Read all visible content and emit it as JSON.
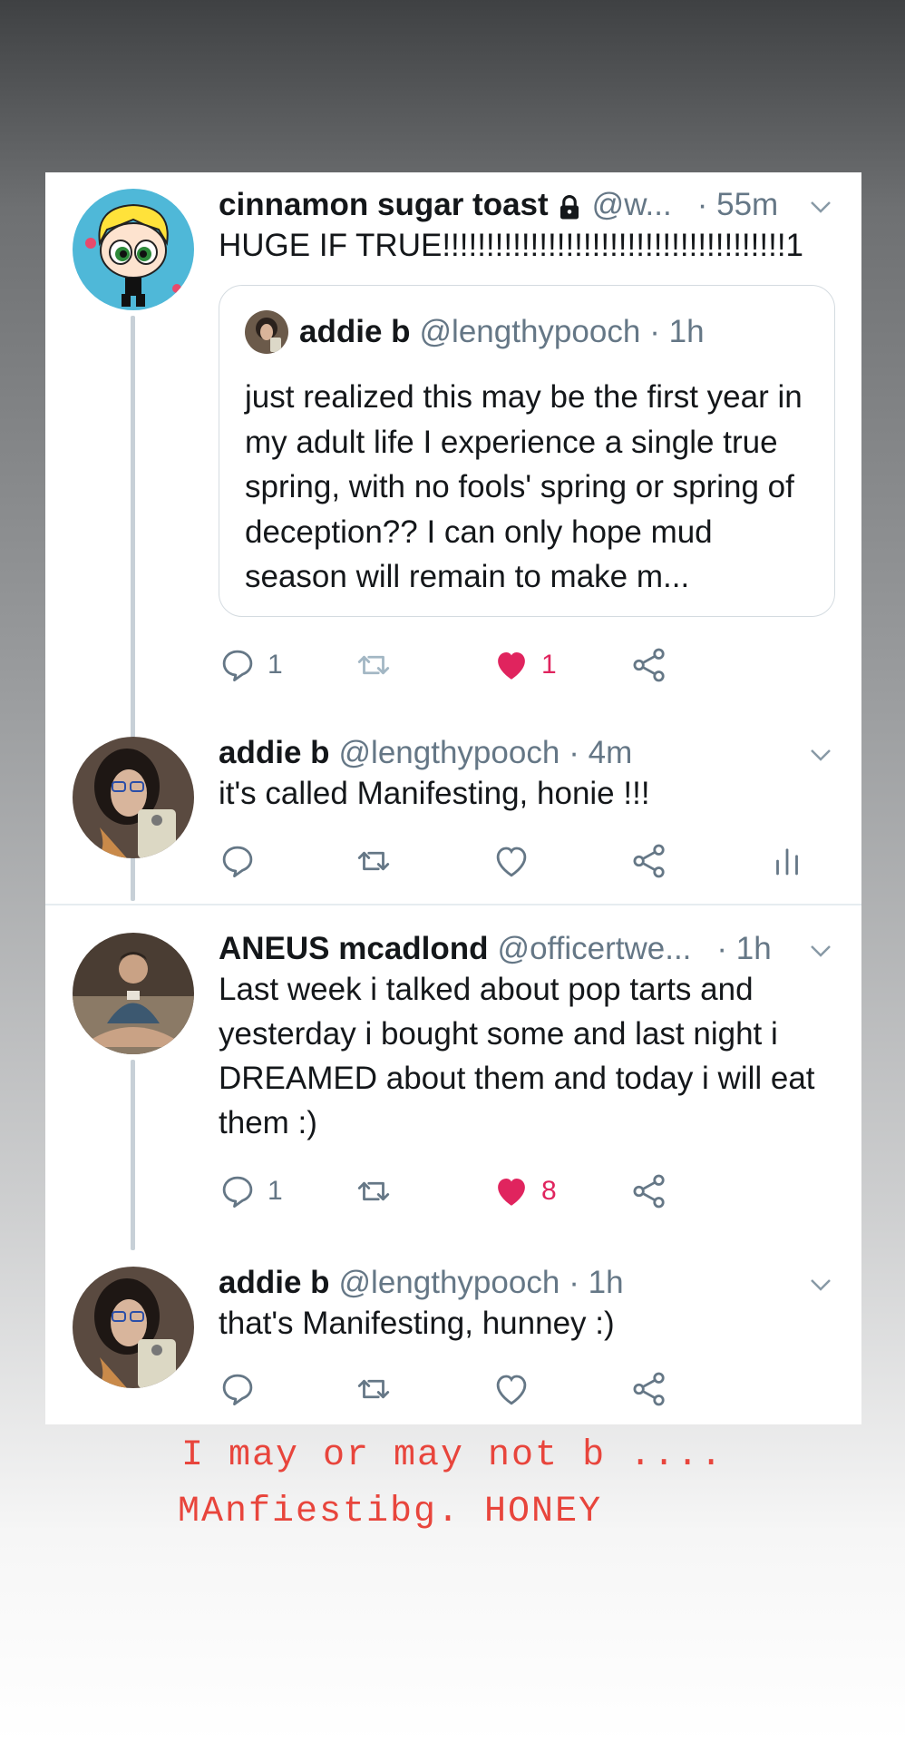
{
  "tweets": [
    {
      "name": "cinnamon sugar toast",
      "handle": "@w...",
      "time": "· 55m",
      "text": "HUGE IF TRUE!!!!!!!!!!!!!!!!!!!!!!!!!!!!!!!!!!!!!!!1",
      "quote": {
        "name": "addie b",
        "handle": "@lengthypooch",
        "time": "· 1h",
        "text": "just realized this may be the first year in my adult life I experience a single true spring, with no fools' spring or spring of deception?? I can only hope mud season will remain to make m..."
      },
      "replies": "1",
      "likes": "1"
    },
    {
      "name": "addie b",
      "handle": "@lengthypooch",
      "time": "· 4m",
      "text": "it's called Manifesting, honie !!!"
    },
    {
      "name": "ANEUS mcadlond",
      "handle": "@officertwe...",
      "time": "· 1h",
      "text": "Last week i talked about pop tarts and yesterday i bought some and last night i DREAMED about them and today i will eat them :)",
      "replies": "1",
      "likes": "8"
    },
    {
      "name": "addie b",
      "handle": "@lengthypooch",
      "time": "· 1h",
      "text": "that's Manifesting, hunney :)"
    }
  ],
  "caption": {
    "line1": "I may or may not b ....",
    "line2": "MAnfiestibg. HONEY"
  },
  "colors": {
    "like": "#e0245e",
    "icon": "#657786",
    "caption": "#e8453c"
  }
}
